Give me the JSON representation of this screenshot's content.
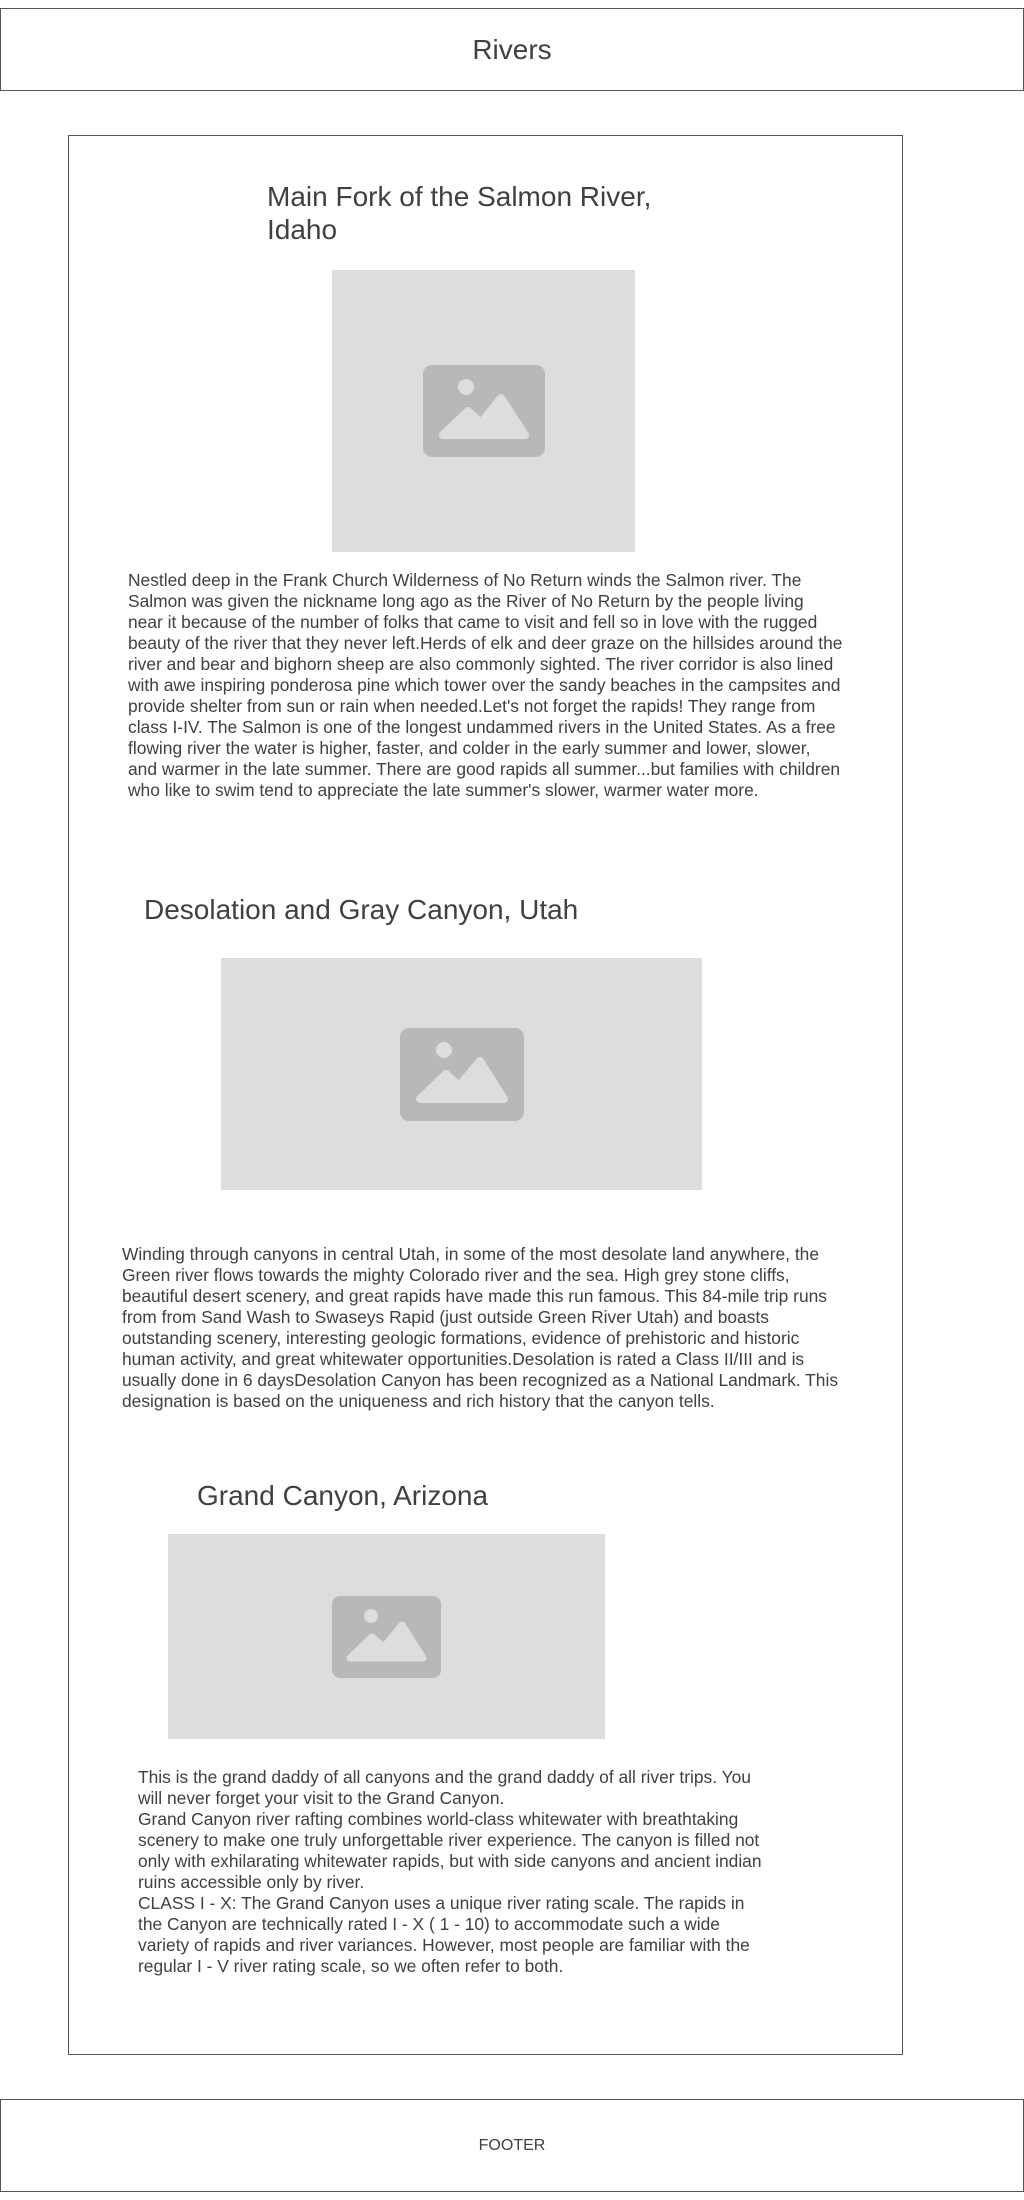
{
  "header": {
    "title": "Rivers"
  },
  "sections": [
    {
      "title": "Main Fork of the Salmon River,\nIdaho",
      "image_icon": "image-placeholder-icon",
      "text": "Nestled deep in the Frank Church Wilderness of No Return winds the Salmon river. The Salmon was given the nickname long ago as the River of No Return by the people living near it because of the number of folks that came to visit and fell so in love with the rugged beauty of the river that they never left.Herds of elk and deer graze on the hillsides around the river and bear and bighorn sheep are also commonly sighted. The river corridor is also lined with awe inspiring ponderosa pine which tower over the sandy beaches in the campsites and provide shelter from sun or rain when needed.Let's not forget the rapids! They range from class I-IV. The Salmon is one of the longest undammed rivers in the United States. As a free flowing river the water is higher, faster, and colder in the early summer and lower, slower, and warmer in the late summer. There are good rapids all summer...but families with children who like to swim tend to appreciate the late summer's slower, warmer water more."
    },
    {
      "title": "Desolation and Gray Canyon, Utah",
      "image_icon": "image-placeholder-icon",
      "text": "Winding through canyons in central Utah, in some of the most desolate land anywhere, the Green river flows towards the mighty Colorado river and the sea. High grey stone cliffs, beautiful desert scenery, and great rapids have made this run famous. This 84-mile trip runs from from Sand Wash to Swaseys Rapid (just outside Green River Utah) and boasts outstanding scenery, interesting geologic formations, evidence of prehistoric and historic human activity, and great whitewater opportunities.Desolation is rated a Class II/III and is usually done in 6 daysDesolation Canyon has been recognized as a National Landmark.  This designation is based on the uniqueness and rich history that the canyon tells."
    },
    {
      "title": "Grand Canyon, Arizona",
      "image_icon": "image-placeholder-icon",
      "text": "This is the grand daddy of all canyons and the grand daddy of all river trips. You will never forget your visit to the Grand Canyon.\nGrand Canyon river rafting combines world-class whitewater with breathtaking scenery to make one truly unforgettable river experience. The canyon is filled not only with exhilarating whitewater rapids, but with side canyons and ancient indian ruins accessible only by river.\nCLASS I - X: The Grand Canyon uses a unique river rating scale. The rapids in the Canyon are technically rated I - X ( 1 - 10) to accommodate such a wide variety of rapids and river variances. However, most people are familiar with the regular I - V river rating scale, so we often refer to both."
    }
  ],
  "footer": {
    "label": "FOOTER"
  }
}
